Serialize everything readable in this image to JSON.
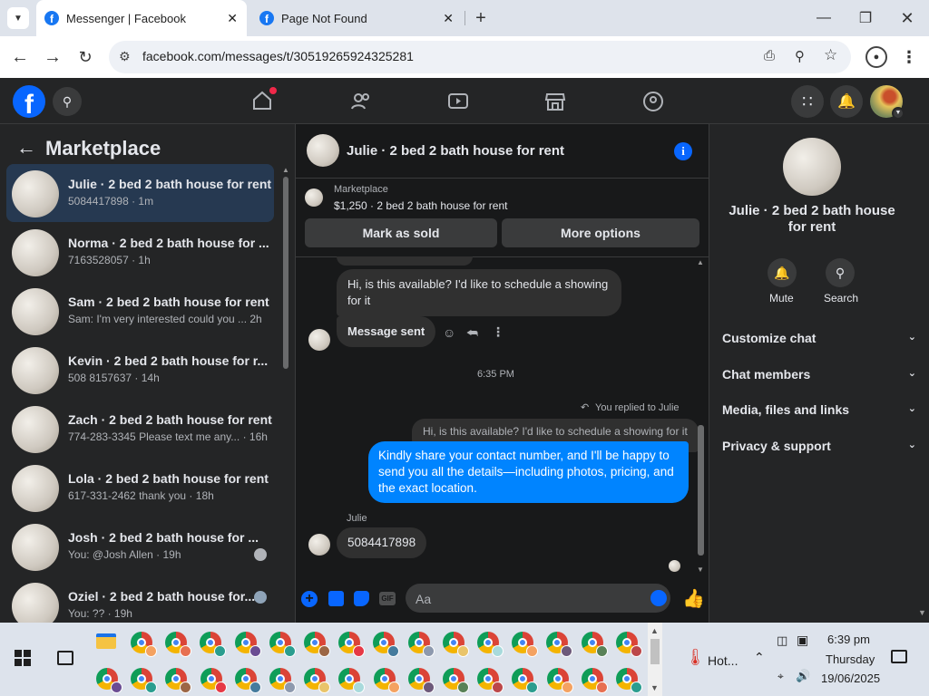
{
  "browser": {
    "tabs": [
      {
        "title": "Messenger | Facebook",
        "active": true
      },
      {
        "title": "Page Not Found",
        "active": false
      }
    ],
    "url": "facebook.com/messages/t/30519265924325281"
  },
  "left": {
    "heading": "Marketplace",
    "conversations": [
      {
        "title": "Julie · 2 bed 2 bath house for rent",
        "sub": "5084417898 · 1m",
        "selected": true
      },
      {
        "title": "Norma · 2 bed 2 bath house for ...",
        "sub": "7163528057 · 1h"
      },
      {
        "title": "Sam · 2 bed 2 bath house for rent",
        "sub": "Sam: I'm very interested could you ...  2h"
      },
      {
        "title": "Kevin · 2 bed 2 bath house for r...",
        "sub": "508 8157637 · 14h"
      },
      {
        "title": "Zach · 2 bed 2 bath house for rent",
        "sub": "774-283-3345 Please text me any... · 16h"
      },
      {
        "title": "Lola · 2 bed 2 bath house for rent",
        "sub": "617-331-2462 thank you · 18h"
      },
      {
        "title": "Josh · 2 bed 2 bath house for ...",
        "sub": "You: @Josh Allen · 19h"
      },
      {
        "title": "Oziel · 2 bed 2 bath house for...",
        "sub": "You: ?? · 19h"
      }
    ]
  },
  "chat": {
    "header_title": "Julie · 2 bed 2 bath house for rent",
    "listing_label": "Marketplace",
    "listing_price": "$1,250 · 2 bed 2 bath house for rent",
    "mark_sold": "Mark as sold",
    "more_options": "More options",
    "msg1": "Hi, is this available? I'd like to schedule a showing for it",
    "msg2": "Message sent",
    "timestamp": "6:35 PM",
    "replied_label": "You replied to Julie",
    "quoted": "Hi, is this available? I'd like to schedule a showing for it",
    "my_msg": "Kindly share your contact number, and I'll be happy to send you all the details—including photos, pricing, and the exact location.",
    "sender": "Julie",
    "their_msg": "5084417898",
    "input_placeholder": "Aa"
  },
  "right": {
    "title": "Julie · 2 bed 2 bath house for rent",
    "mute": "Mute",
    "search": "Search",
    "sections": [
      "Customize chat",
      "Chat members",
      "Media, files and links",
      "Privacy & support"
    ]
  },
  "taskbar": {
    "weather": "Hot...",
    "time": "6:39 pm",
    "day": "Thursday",
    "date": "19/06/2025"
  },
  "colors": {
    "accent": "#0084ff",
    "fb_blue": "#1877f2",
    "selected": "#263951",
    "bg": "#18191a"
  }
}
